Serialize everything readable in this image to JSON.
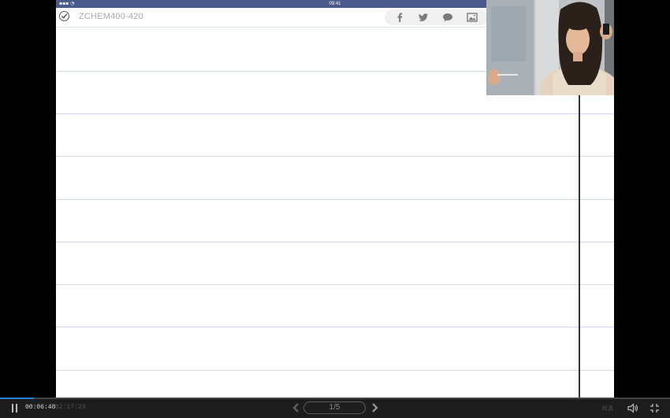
{
  "tablet": {
    "status_time": "09:41",
    "doc_title": "ZCHEM400-420",
    "share_icons": [
      "facebook-icon",
      "twitter-icon",
      "comment-icon",
      "image-icon"
    ]
  },
  "player": {
    "current_time": "00:06:48",
    "total_time": "02:17:23",
    "progress": 0.05,
    "page_indicator": "1/5",
    "right_text": "标清"
  },
  "colors": {
    "tablet_status_bar": "#4a5a8a",
    "rule_line": "#cfd8ea",
    "progress_accent": "#2a7fd6"
  }
}
